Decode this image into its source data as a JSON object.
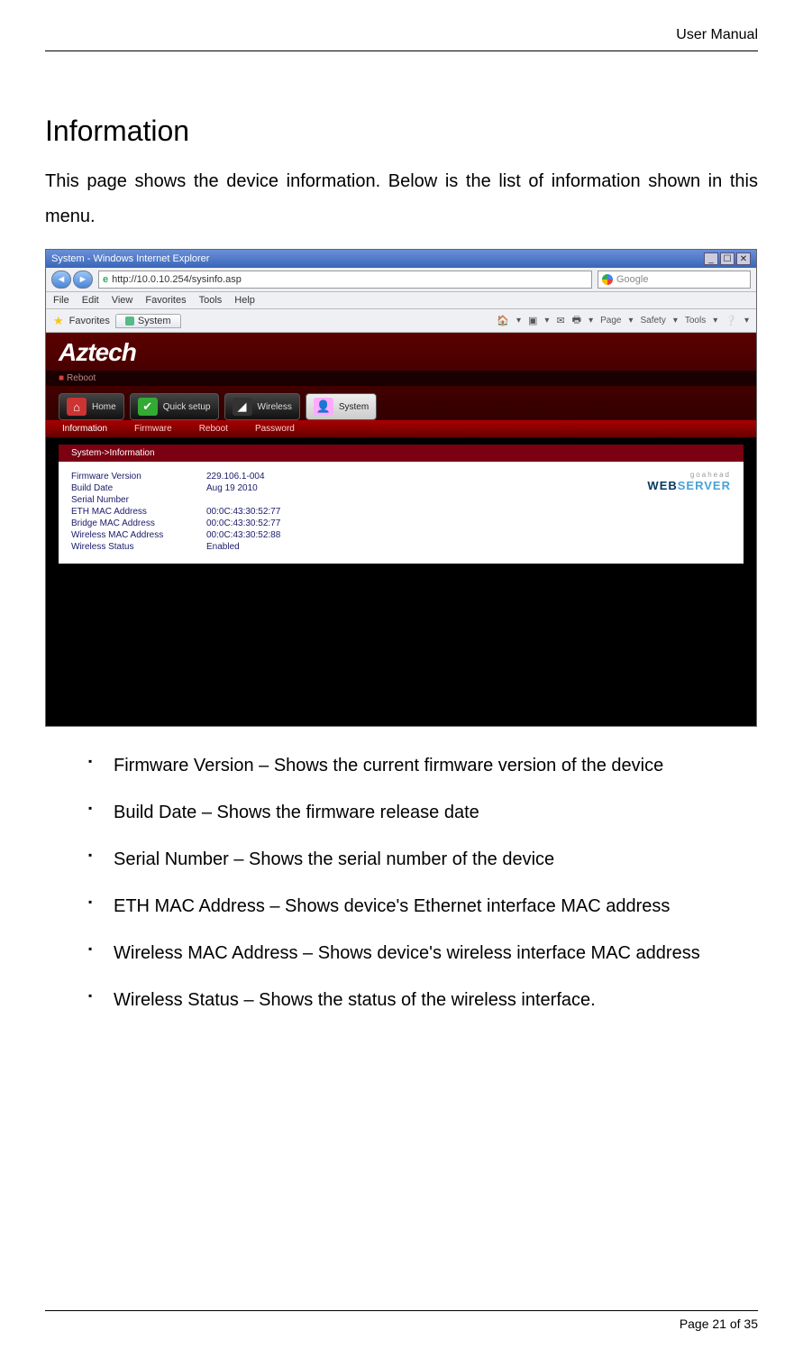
{
  "header": {
    "title": "User Manual"
  },
  "footer": {
    "text": "Page 21 of 35"
  },
  "section": {
    "heading": "Information",
    "intro": "This page shows the device information. Below is the list of information shown in this menu."
  },
  "ie": {
    "title": "System - Windows Internet Explorer",
    "url": "http://10.0.10.254/sysinfo.asp",
    "search_placeholder": "Google",
    "menu": [
      "File",
      "Edit",
      "View",
      "Favorites",
      "Tools",
      "Help"
    ],
    "fav_label": "Favorites",
    "tab_label": "System",
    "tools": [
      "Page",
      "Safety",
      "Tools"
    ]
  },
  "app": {
    "logo": "Aztech",
    "reboot": "Reboot",
    "nav": [
      {
        "label": "Home"
      },
      {
        "label": "Quick setup"
      },
      {
        "label": "Wireless"
      },
      {
        "label": "System"
      }
    ],
    "subnav": [
      "Information",
      "Firmware",
      "Reboot",
      "Password"
    ],
    "breadcrumb": "System->Information",
    "info": [
      {
        "label": "Firmware Version",
        "value": "229.106.1-004"
      },
      {
        "label": "Build Date",
        "value": "Aug 19 2010"
      },
      {
        "label": "Serial Number",
        "value": ""
      },
      {
        "label": "ETH MAC Address",
        "value": "00:0C:43:30:52:77"
      },
      {
        "label": "Bridge MAC Address",
        "value": "00:0C:43:30:52:77"
      },
      {
        "label": "Wireless MAC Address",
        "value": "00:0C:43:30:52:88"
      },
      {
        "label": "Wireless Status",
        "value": "Enabled"
      }
    ],
    "webserver": {
      "top": "goahead",
      "web": "WEB",
      "server": "SERVER"
    }
  },
  "bullets": [
    "Firmware Version – Shows the current firmware version of the device",
    "Build Date – Shows the firmware release date",
    "Serial Number – Shows the serial number of the device",
    "ETH MAC Address – Shows device's Ethernet interface MAC address",
    "Wireless MAC Address – Shows device's wireless interface MAC address",
    "Wireless Status – Shows the status of the wireless interface."
  ]
}
